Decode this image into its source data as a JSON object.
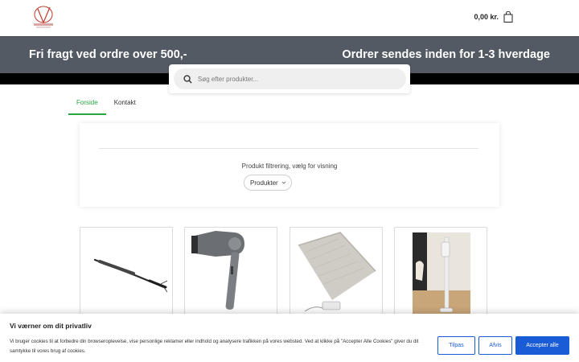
{
  "header": {
    "cart_total": "0,00 kr."
  },
  "banner": {
    "left_text": "Fri fragt ved ordre over 500,-",
    "right_text": "Ordrer sendes inden for 1-3 hverdage"
  },
  "search": {
    "placeholder": "Søg efter produkter...",
    "value": ""
  },
  "tabs": [
    {
      "label": "Forside",
      "active": true
    },
    {
      "label": "Kontakt",
      "active": false
    }
  ],
  "filter": {
    "label": "Produkt filtrering, vælg for visning",
    "selected": "Produkter"
  },
  "products": [
    {
      "icon": "curling-iron-image"
    },
    {
      "icon": "hair-dryer-image"
    },
    {
      "icon": "heated-blanket-image"
    },
    {
      "icon": "stick-vacuum-image"
    }
  ],
  "cookie": {
    "title": "Vi værner om dit privatliv",
    "text": "Vi bruger cookies til at forbedre din browseroplevelse, vise personlige reklamer eller indhold og analysere trafikken på vores websted. Ved at klikke på \"Accepter Alle Cookies\" giver du dit samtykke til vores brug af cookies.",
    "customize_label": "Tilpas",
    "reject_label": "Afvis",
    "accept_label": "Accepter alle"
  },
  "colors": {
    "banner_bg": "#535a63",
    "active_tab": "#27a744",
    "cookie_button": "#1a5bd6"
  }
}
